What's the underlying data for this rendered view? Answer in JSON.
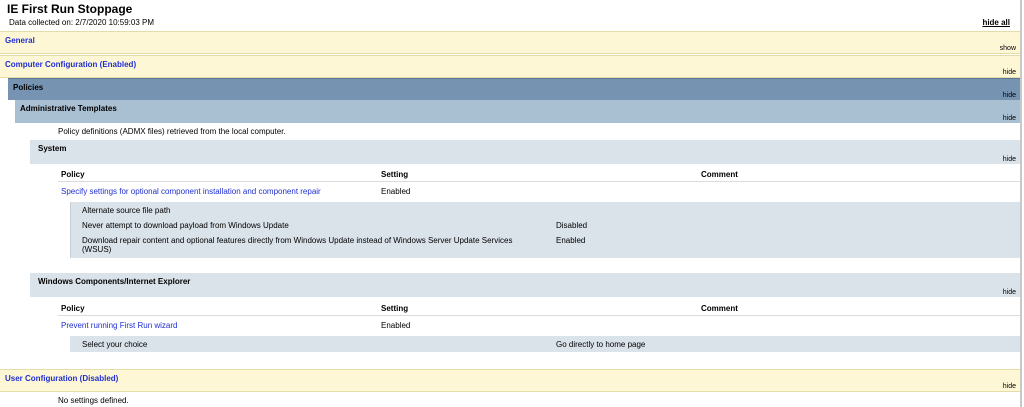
{
  "header": {
    "title": "IE First Run Stoppage",
    "collected": "Data collected on: 2/7/2020 10:59:03 PM",
    "hide_all": "hide all"
  },
  "general": {
    "label": "General",
    "toggle": "show"
  },
  "computer_config": {
    "label": "Computer Configuration (Enabled)",
    "toggle": "hide"
  },
  "policies": {
    "label": "Policies",
    "toggle": "hide"
  },
  "admin_templates": {
    "label": "Administrative Templates",
    "toggle": "hide",
    "note": "Policy definitions (ADMX files) retrieved from the local computer."
  },
  "system": {
    "label": "System",
    "toggle": "hide",
    "columns": {
      "policy": "Policy",
      "setting": "Setting",
      "comment": "Comment"
    },
    "policy_name": "Specify settings for optional component installation and component repair",
    "policy_setting": "Enabled",
    "details": [
      {
        "label": "Alternate source file path",
        "value": ""
      },
      {
        "label": "Never attempt to download payload from Windows Update",
        "value": "Disabled"
      },
      {
        "label": "Download repair content and optional features directly from Windows Update instead of Windows Server Update Services (WSUS)",
        "value": "Enabled"
      }
    ]
  },
  "ie": {
    "label": "Windows Components/Internet Explorer",
    "toggle": "hide",
    "columns": {
      "policy": "Policy",
      "setting": "Setting",
      "comment": "Comment"
    },
    "policy_name": "Prevent running First Run wizard",
    "policy_setting": "Enabled",
    "detail": {
      "label": "Select your choice",
      "value": "Go directly to home page"
    }
  },
  "user_config": {
    "label": "User Configuration (Disabled)",
    "toggle": "hide",
    "note": "No settings defined."
  }
}
